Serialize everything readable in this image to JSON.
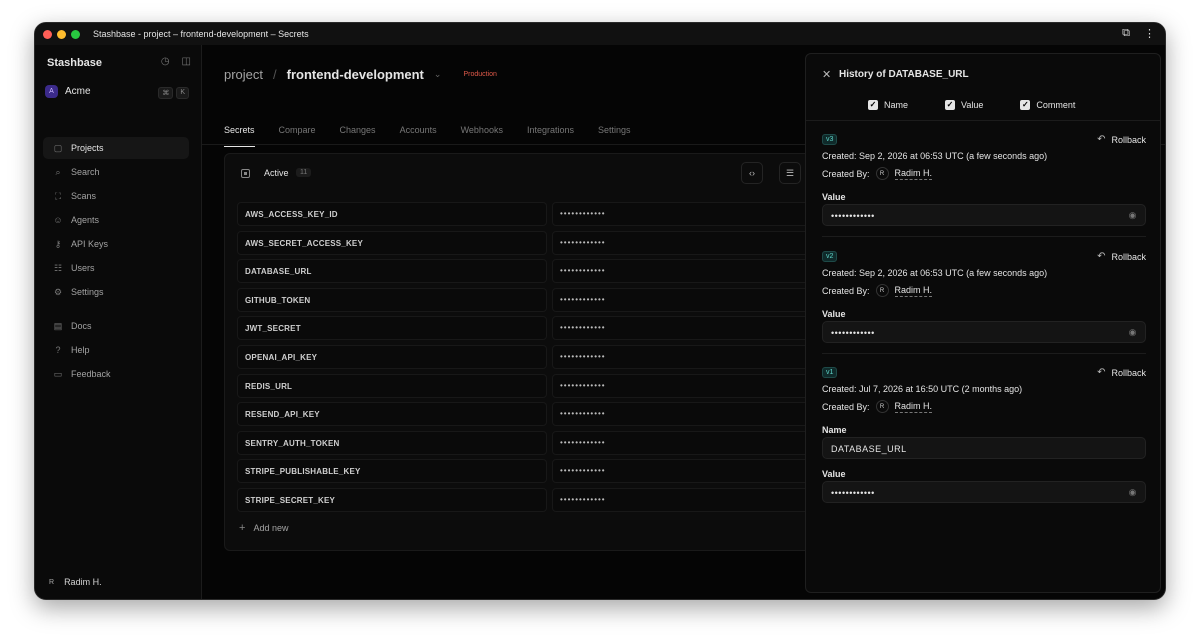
{
  "window": {
    "title": "Stashbase - project – frontend-development – Secrets"
  },
  "sidebar": {
    "brand": "Stashbase",
    "org": {
      "initial": "A",
      "name": "Acme",
      "shortcut": [
        "⌘",
        "K"
      ]
    },
    "items": [
      {
        "label": "Projects",
        "icon": "folder-icon",
        "glyph": "▢",
        "active": true
      },
      {
        "label": "Search",
        "icon": "search-icon",
        "glyph": "⌕",
        "active": false
      },
      {
        "label": "Scans",
        "icon": "scan-icon",
        "glyph": "⛶",
        "active": false
      },
      {
        "label": "Agents",
        "icon": "bot-icon",
        "glyph": "☺",
        "active": false
      },
      {
        "label": "API Keys",
        "icon": "key-icon",
        "glyph": "⚷",
        "active": false
      },
      {
        "label": "Users",
        "icon": "users-icon",
        "glyph": "☷",
        "active": false
      },
      {
        "label": "Settings",
        "icon": "gear-icon",
        "glyph": "⚙",
        "active": false
      }
    ],
    "secondary": [
      {
        "label": "Docs",
        "icon": "book-icon",
        "glyph": "▤"
      },
      {
        "label": "Help",
        "icon": "help-icon",
        "glyph": "?"
      },
      {
        "label": "Feedback",
        "icon": "chat-icon",
        "glyph": "▭"
      }
    ],
    "user": {
      "initial": "R",
      "name": "Radim H."
    }
  },
  "main": {
    "breadcrumb": {
      "project": "project",
      "separator": "/",
      "env": "frontend-development",
      "badge": "Production"
    },
    "tabs": [
      "Secrets",
      "Compare",
      "Changes",
      "Accounts",
      "Webhooks",
      "Integrations",
      "Settings"
    ],
    "active_tab": "Secrets",
    "panel": {
      "filter_label": "Active",
      "count": "11",
      "secrets": [
        {
          "key": "AWS_ACCESS_KEY_ID",
          "value": "••••••••••••"
        },
        {
          "key": "AWS_SECRET_ACCESS_KEY",
          "value": "••••••••••••"
        },
        {
          "key": "DATABASE_URL",
          "value": "••••••••••••"
        },
        {
          "key": "GITHUB_TOKEN",
          "value": "••••••••••••"
        },
        {
          "key": "JWT_SECRET",
          "value": "••••••••••••"
        },
        {
          "key": "OPENAI_API_KEY",
          "value": "••••••••••••"
        },
        {
          "key": "REDIS_URL",
          "value": "••••••••••••"
        },
        {
          "key": "RESEND_API_KEY",
          "value": "••••••••••••"
        },
        {
          "key": "SENTRY_AUTH_TOKEN",
          "value": "••••••••••••"
        },
        {
          "key": "STRIPE_PUBLISHABLE_KEY",
          "value": "••••••••••••"
        },
        {
          "key": "STRIPE_SECRET_KEY",
          "value": "••••••••••••"
        }
      ],
      "add_new": "Add new"
    }
  },
  "history": {
    "title": "History of DATABASE_URL",
    "filters": [
      {
        "label": "Name",
        "checked": true
      },
      {
        "label": "Value",
        "checked": true
      },
      {
        "label": "Comment",
        "checked": true
      }
    ],
    "rollback_label": "Rollback",
    "created_by_label": "Created By:",
    "value_label": "Value",
    "name_label": "Name",
    "versions": [
      {
        "badge": "v3",
        "created": "Created: Sep 2, 2026 at 06:53 UTC (a few seconds ago)",
        "author_initial": "R",
        "author": "Radim H.",
        "value": "••••••••••••"
      },
      {
        "badge": "v2",
        "created": "Created: Sep 2, 2026 at 06:53 UTC (a few seconds ago)",
        "author_initial": "R",
        "author": "Radim H.",
        "value": "••••••••••••"
      },
      {
        "badge": "v1",
        "created": "Created: Jul 7, 2026 at 16:50 UTC (2 months ago)",
        "author_initial": "R",
        "author": "Radim H.",
        "name": "DATABASE_URL",
        "value": "••••••••••••"
      }
    ]
  }
}
